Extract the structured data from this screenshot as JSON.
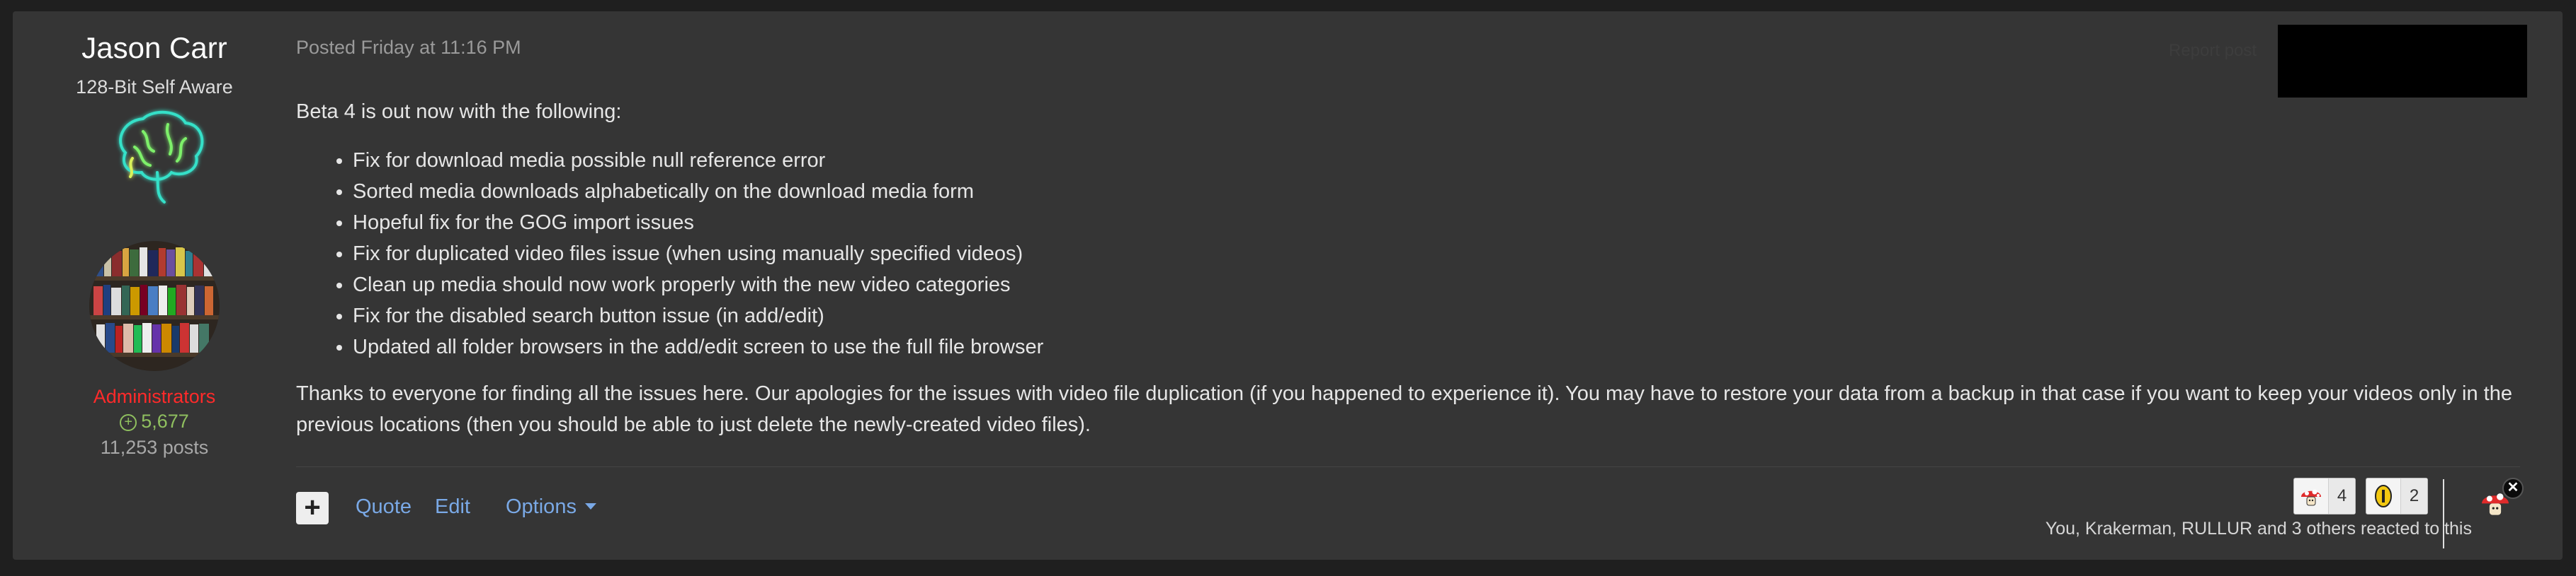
{
  "author": {
    "name": "Jason Carr",
    "title": "128-Bit Self Aware",
    "rank_icon": "neon-brain-icon",
    "avatar": "bookshelf-avatar",
    "group": "Administrators",
    "reputation": "5,677",
    "posts": "11,253 posts"
  },
  "post": {
    "posted": "Posted Friday at 11:16 PM",
    "report_label": "Report post",
    "intro": "Beta 4 is out now with the following:",
    "items": [
      "Fix for download media possible null reference error",
      "Sorted media downloads alphabetically on the download media form",
      "Hopeful fix for the GOG import issues",
      "Fix for duplicated video files issue (when using manually specified videos)",
      "Clean up media should now work properly with the new video categories",
      "Fix for the disabled search button issue (in add/edit)",
      "Updated all folder browsers in the add/edit screen to use the full file browser"
    ],
    "closing": "Thanks to everyone for finding all the issues here. Our apologies for the issues with video file duplication (if you happened to experience it). You may have to restore your data from a backup in that case if you want to keep your videos only in the previous locations (then you should be able to just delete the newly-created video files)."
  },
  "actions": {
    "plus": "+",
    "quote": "Quote",
    "edit": "Edit",
    "options": "Options"
  },
  "reactions": {
    "items": [
      {
        "icon": "mushroom-icon",
        "count": "4"
      },
      {
        "icon": "coin-icon",
        "count": "2"
      }
    ],
    "summary": "You, Krakerman, RULLUR and 3 others reacted to this",
    "close": "✕"
  },
  "colors": {
    "background": "#1f1f1f",
    "panel": "#353535",
    "link": "#7aa9e6",
    "admin_group": "#ff2a2a",
    "reputation": "#8fbf5f"
  }
}
